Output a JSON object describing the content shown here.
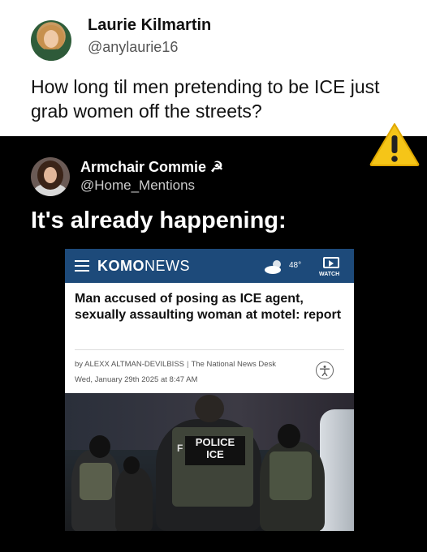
{
  "top_tweet": {
    "name": "Laurie Kilmartin",
    "handle": "@anylaurie16",
    "text": "How long til men pretending to be ICE just grab women off the streets?"
  },
  "reply_tweet": {
    "name": "Armchair Commie ☭",
    "handle": "@Home_Mentions",
    "text": "It's already happening:"
  },
  "article": {
    "brand_bold": "KOMO",
    "brand_rest": "NEWS",
    "temperature": "48°",
    "watch_label": "WATCH",
    "headline": "Man accused of posing as ICE agent, sexually assaulting woman at motel: report",
    "author": "by ALEXX ALTMAN-DEVILBISS",
    "source": "The National News Desk",
    "date": "Wed, January 29th 2025 at 8:47 AM",
    "photo_patch_line1": "POLICE",
    "photo_patch_line2": "ICE",
    "photo_patch_side": "F"
  },
  "icons": {
    "warning": "warning-icon",
    "menu": "hamburger-menu-icon",
    "weather": "partly-cloudy-icon",
    "watch": "play-icon",
    "accessibility": "accessibility-icon"
  },
  "colors": {
    "navbar": "#1d4a7a",
    "warning": "#f5c518"
  }
}
